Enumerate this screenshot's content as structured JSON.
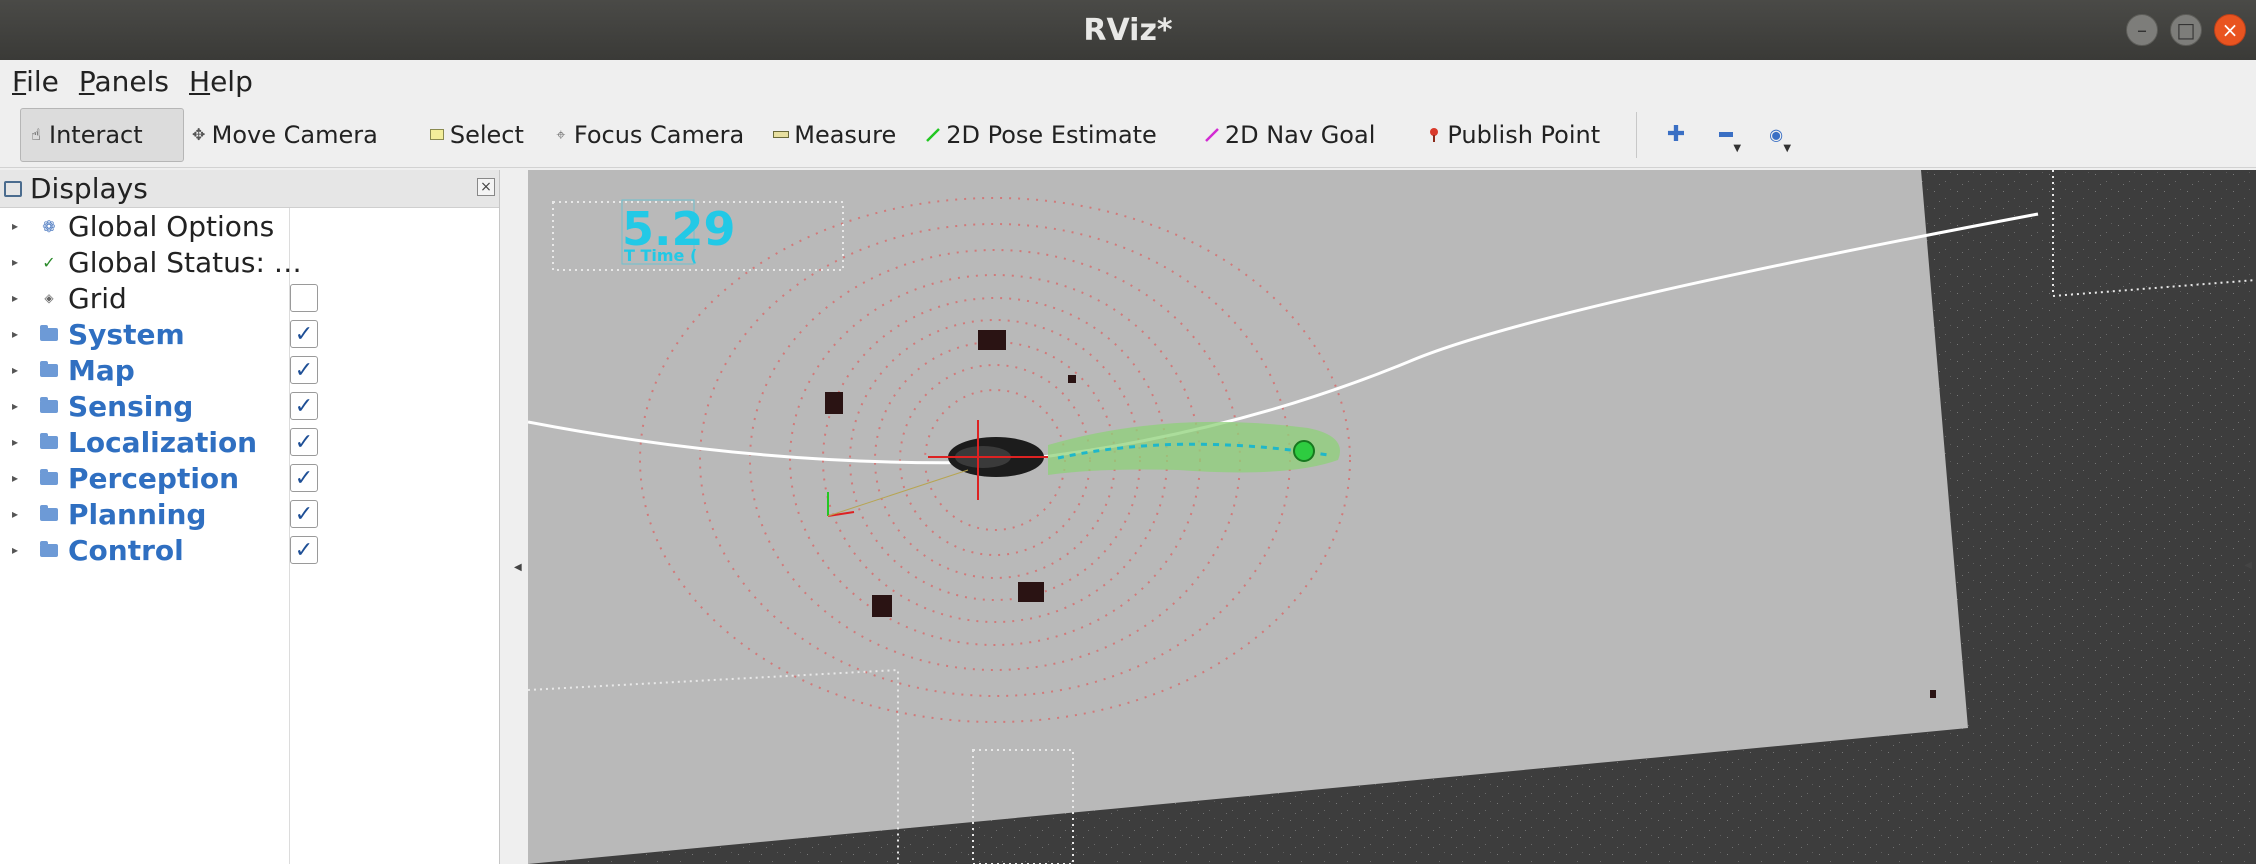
{
  "window": {
    "title": "RViz*"
  },
  "menu": [
    {
      "key": "F",
      "rest": "ile"
    },
    {
      "key": "P",
      "rest": "anels"
    },
    {
      "key": "H",
      "rest": "elp"
    }
  ],
  "toolbar": {
    "tools": [
      {
        "label": "Interact",
        "icon": "hand-icon"
      },
      {
        "label": "Move Camera",
        "icon": "move-icon"
      },
      {
        "label": "Select",
        "icon": "select-icon"
      },
      {
        "label": "Focus Camera",
        "icon": "focus-icon"
      },
      {
        "label": "Measure",
        "icon": "ruler-icon"
      },
      {
        "label": "2D Pose Estimate",
        "icon": "pose-arrow-icon"
      },
      {
        "label": "2D Nav Goal",
        "icon": "nav-arrow-icon"
      },
      {
        "label": "Publish Point",
        "icon": "pin-icon"
      }
    ],
    "add_icon": "plus-icon",
    "remove_icon": "minus-icon",
    "view_icon": "eye-icon"
  },
  "displays": {
    "title": "Displays",
    "items": [
      {
        "label": "Global Options",
        "icon": "gear-icon",
        "group": false,
        "checkbox": null
      },
      {
        "label": "Global Status: …",
        "icon": "check-icon",
        "group": false,
        "checkbox": null
      },
      {
        "label": "Grid",
        "icon": "grid-icon",
        "group": false,
        "checkbox": false
      },
      {
        "label": "System",
        "icon": "folder-icon",
        "group": true,
        "checkbox": true
      },
      {
        "label": "Map",
        "icon": "folder-icon",
        "group": true,
        "checkbox": true
      },
      {
        "label": "Sensing",
        "icon": "folder-icon",
        "group": true,
        "checkbox": true
      },
      {
        "label": "Localization",
        "icon": "folder-icon",
        "group": true,
        "checkbox": true
      },
      {
        "label": "Perception",
        "icon": "folder-icon",
        "group": true,
        "checkbox": true
      },
      {
        "label": "Planning",
        "icon": "folder-icon",
        "group": true,
        "checkbox": true
      },
      {
        "label": "Control",
        "icon": "folder-icon",
        "group": true,
        "checkbox": true
      }
    ]
  },
  "viewport": {
    "overlay_value": "5.29",
    "overlay_caption": "T Time (",
    "colors": {
      "map_floor": "#b9b9b9",
      "background": "#3d3d3d",
      "path": "#ffffff",
      "trajectory": "#8fd17a",
      "goal": "#2ecc40",
      "overlay": "#22c9e6"
    }
  }
}
